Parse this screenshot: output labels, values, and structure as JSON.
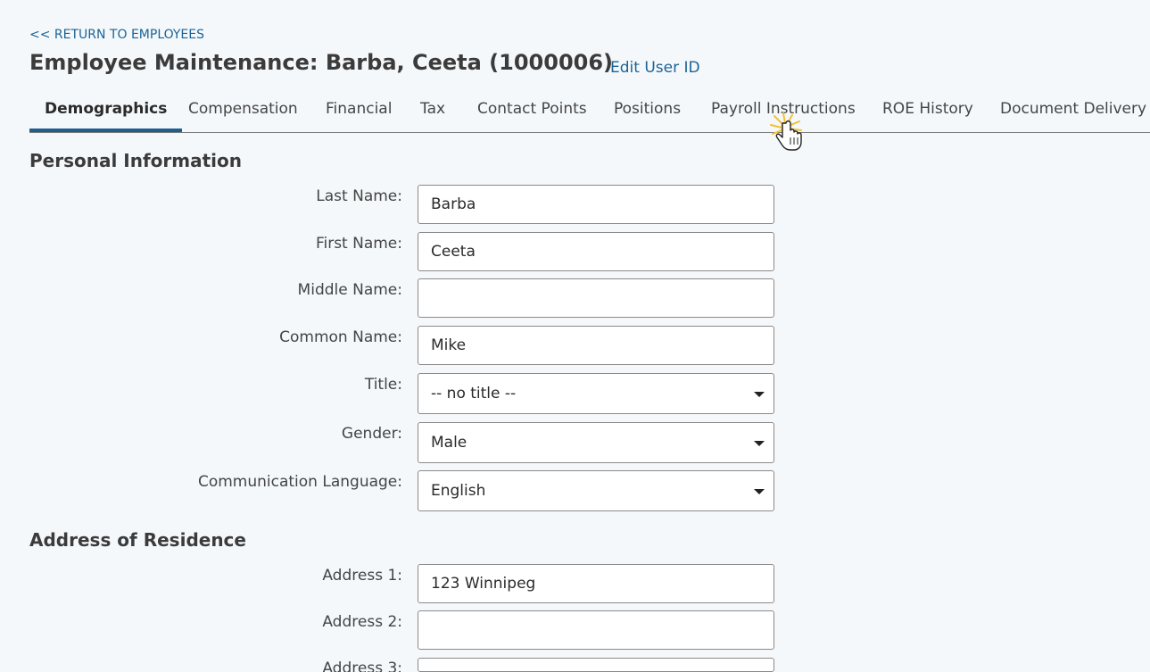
{
  "nav": {
    "return_link": "<< RETURN TO EMPLOYEES"
  },
  "header": {
    "title": "Employee Maintenance:  Barba, Ceeta (1000006)",
    "edit_user_id": "Edit User ID"
  },
  "tabs": [
    {
      "label": "Demographics",
      "active": true
    },
    {
      "label": "Compensation",
      "active": false
    },
    {
      "label": "Financial",
      "active": false
    },
    {
      "label": "Tax",
      "active": false
    },
    {
      "label": "Contact Points",
      "active": false
    },
    {
      "label": "Positions",
      "active": false
    },
    {
      "label": "Payroll Instructions",
      "active": false
    },
    {
      "label": "ROE History",
      "active": false
    },
    {
      "label": "Document Delivery",
      "active": false
    }
  ],
  "personal_info": {
    "heading": "Personal Information",
    "last_name": {
      "label": "Last Name:",
      "value": "Barba"
    },
    "first_name": {
      "label": "First Name:",
      "value": "Ceeta"
    },
    "middle_name": {
      "label": "Middle Name:",
      "value": ""
    },
    "common_name": {
      "label": "Common Name:",
      "value": "Mike"
    },
    "title": {
      "label": "Title:",
      "value": "-- no title --"
    },
    "gender": {
      "label": "Gender:",
      "value": "Male"
    },
    "language": {
      "label": "Communication Language:",
      "value": "English"
    }
  },
  "address": {
    "heading": "Address of Residence",
    "address1": {
      "label": "Address 1:",
      "value": "123 Winnipeg"
    },
    "address2": {
      "label": "Address 2:",
      "value": ""
    },
    "address3": {
      "label": "Address 3:",
      "value": ""
    }
  },
  "colors": {
    "link": "#1a6496",
    "tab_active_underline": "#1f5f8d",
    "background": "#f5f8fb"
  },
  "icons": {
    "cursor": "hand-pointer-click-icon",
    "dropdown": "caret-down-icon"
  }
}
